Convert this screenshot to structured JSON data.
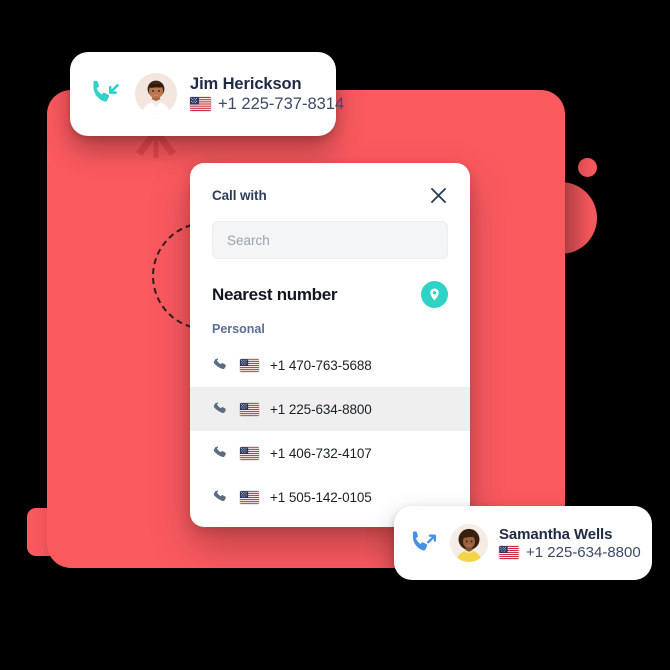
{
  "theme": {
    "red": "#fb5a5f",
    "red_dark": "#e8474d",
    "teal": "#2ed3c6",
    "blue": "#4a90e2",
    "navy": "#2c3d5c",
    "row_highlight": "#efefef"
  },
  "background": {
    "panel_name": "red-rounded-panel",
    "decorations": [
      "up-arrow-marker",
      "dashed-circle",
      "right-bulge-circle",
      "small-red-dot",
      "left-tab-nub"
    ]
  },
  "incoming_card": {
    "icon": "incoming-call-icon",
    "avatar": "avatar-photo",
    "name": "Jim Herickson",
    "flag": "us-flag-icon",
    "number": "+1 225-737-8314"
  },
  "outgoing_card": {
    "icon": "outgoing-call-icon",
    "avatar": "avatar-photo",
    "name": "Samantha Wells",
    "flag": "us-flag-icon",
    "number": "+1 225-634-8800"
  },
  "dialog": {
    "title": "Call with",
    "close_icon": "close-icon",
    "search": {
      "placeholder": "Search",
      "value": ""
    },
    "nearest": {
      "heading": "Nearest number",
      "pin_icon": "location-pin-icon"
    },
    "group_label": "Personal",
    "numbers": [
      {
        "icon": "phone-icon",
        "flag": "us-flag-icon",
        "number": "+1 470-763-5688",
        "selected": false
      },
      {
        "icon": "phone-icon",
        "flag": "us-flag-icon",
        "number": "+1 225-634-8800",
        "selected": true
      },
      {
        "icon": "phone-icon",
        "flag": "us-flag-icon",
        "number": "+1 406-732-4107",
        "selected": false
      },
      {
        "icon": "phone-icon",
        "flag": "us-flag-icon",
        "number": "+1 505-142-0105",
        "selected": false
      }
    ]
  }
}
